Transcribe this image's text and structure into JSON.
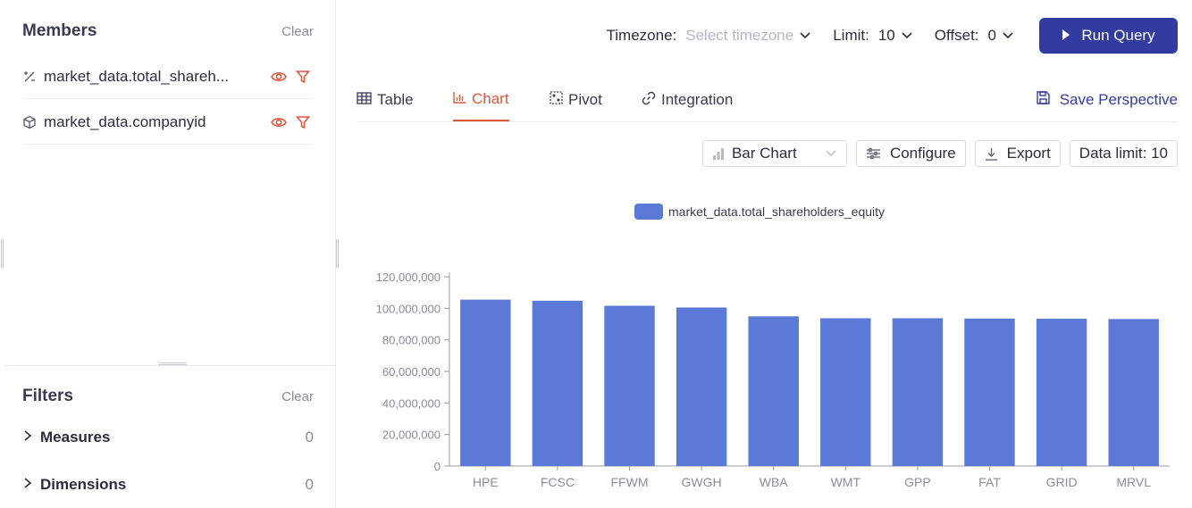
{
  "members": {
    "title": "Members",
    "clear_label": "Clear",
    "items": [
      {
        "label": "market_data.total_shareh...",
        "icon": "measure-icon"
      },
      {
        "label": "market_data.companyid",
        "icon": "dimension-cube-icon"
      }
    ]
  },
  "filters": {
    "title": "Filters",
    "clear_label": "Clear",
    "items": [
      {
        "label": "Measures",
        "count": "0"
      },
      {
        "label": "Dimensions",
        "count": "0"
      }
    ]
  },
  "query": {
    "timezone_label": "Timezone:",
    "timezone_placeholder": "Select timezone",
    "limit_label": "Limit:",
    "limit_value": "10",
    "offset_label": "Offset:",
    "offset_value": "0",
    "run_label": "Run Query"
  },
  "tabs": [
    {
      "label": "Table",
      "icon": "table-icon"
    },
    {
      "label": "Chart",
      "icon": "bar-chart-icon",
      "active": true
    },
    {
      "label": "Pivot",
      "icon": "pivot-icon"
    },
    {
      "label": "Integration",
      "icon": "link-icon"
    }
  ],
  "save_perspective_label": "Save Perspective",
  "toolbar": {
    "chart_type": "Bar Chart",
    "configure_label": "Configure",
    "export_label": "Export",
    "data_limit_label": "Data limit: 10"
  },
  "colors": {
    "accent": "#e0573a",
    "primary": "#323ca0",
    "bar": "#5b79d6"
  },
  "chart_data": {
    "type": "bar",
    "categories": [
      "HPE",
      "FCSC",
      "FFWM",
      "GWGH",
      "WBA",
      "WMT",
      "GPP",
      "FAT",
      "GRID",
      "MRVL"
    ],
    "series": [
      {
        "name": "market_data.total_shareholders_equity",
        "values": [
          105500000,
          104800000,
          101600000,
          100500000,
          94900000,
          93700000,
          93700000,
          93500000,
          93400000,
          93200000
        ]
      }
    ],
    "yticks": [
      "0",
      "20,000,000",
      "40,000,000",
      "60,000,000",
      "80,000,000",
      "100,000,000",
      "120,000,000"
    ],
    "ylim": [
      0,
      120000000
    ],
    "legend": "top-center",
    "grid": false
  }
}
